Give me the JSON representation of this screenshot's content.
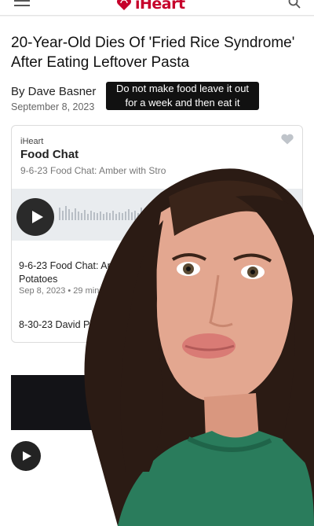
{
  "brand": {
    "name": "iHeart",
    "accent": "#c6002b"
  },
  "header_icons": {
    "menu": "hamburger-menu-icon",
    "search": "search-icon"
  },
  "article": {
    "headline": "20-Year-Old Dies Of 'Fried Rice Syndrome' After Eating Leftover Pasta",
    "byline": "By Dave Basner",
    "date": "September 8, 2023"
  },
  "caption": "Do not make food leave it out for a week and then eat it",
  "player": {
    "source": "iHeart",
    "title": "Food Chat",
    "subtitle": "9-6-23 Food Chat: Amber with Stro",
    "episodes": [
      {
        "title": "9-6-23 Food Chat: Amb Potatoes",
        "meta": "Sep 8, 2023 • 29 mins"
      },
      {
        "title": "8-30-23 David Pi Interview"
      }
    ]
  }
}
